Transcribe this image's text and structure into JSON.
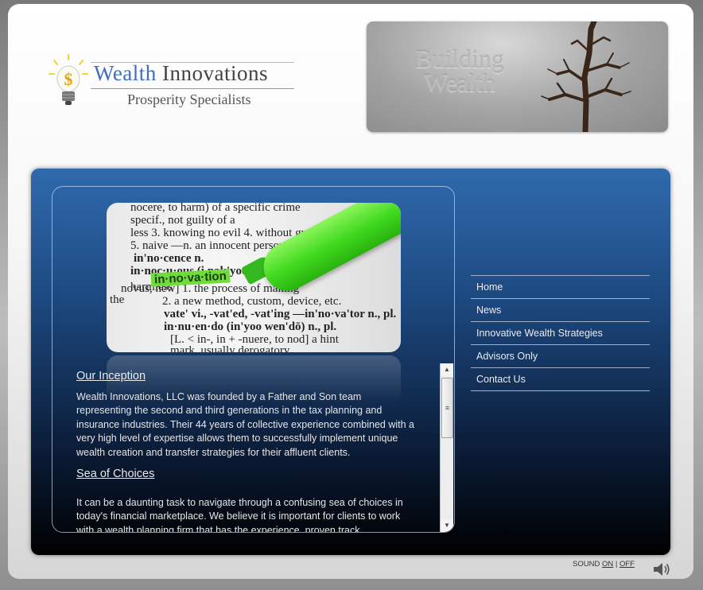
{
  "logo": {
    "title_part1": "Wealth",
    "title_part2": "Innovations",
    "subtitle": "Prosperity Specialists",
    "icon": "lightbulb-dollar-icon"
  },
  "banner": {
    "line1": "Building",
    "line2": "Wealth",
    "image": "bare-tree"
  },
  "photo": {
    "lines": [
      "nocere, to harm) of a specific crime",
      "specif., not guilty of a",
      "less 3. knowing no evil 4. without guile",
      "5. naive —n. an innocent person",
      "in'no·cence n.",
      "in·noc·u·ous (i nak'yoo",
      "harmless",
      "the",
      "novus, new] 1. the process of making",
      "2. a new method, custom, device, etc.",
      "vate' vi., -vat'ed, -vat'ing —in'no·va'tor n., pl.",
      "in·nu·en·do (in'yoo wen'dō) n., pl.",
      "[L. < in-, in + -nuere, to nod] a hint",
      "mark, usually derogatory"
    ],
    "highlighted_word": "in·no·va·tion"
  },
  "content": {
    "sections": [
      {
        "heading": "Our Inception",
        "body": "Wealth Innovations, LLC was founded by a Father and Son team representing the second and third generations in the tax planning and insurance industries. Their 44 years of collective experience combined with a very high level of expertise allows them to successfully implement unique wealth creation and transfer strategies for their affluent clients."
      },
      {
        "heading": "Sea of Choices",
        "body": "It can be a daunting task to navigate through a confusing sea of choices in today's financial marketplace. We believe it is important for clients to work with a wealth planning firm that has the experience, proven track"
      }
    ]
  },
  "nav": {
    "items": [
      {
        "label": "Home"
      },
      {
        "label": "News"
      },
      {
        "label": "Innovative Wealth Strategies"
      },
      {
        "label": "Advisors Only"
      },
      {
        "label": "Contact Us"
      }
    ]
  },
  "sound": {
    "label": "SOUND",
    "on": "ON",
    "separator": "|",
    "off": "OFF",
    "icon": "speaker-icon"
  },
  "colors": {
    "panel_top": "#2f6aad",
    "panel_bottom": "#000000",
    "logo_blue": "#3f6ec0",
    "marker_green": "#3fd81e"
  }
}
